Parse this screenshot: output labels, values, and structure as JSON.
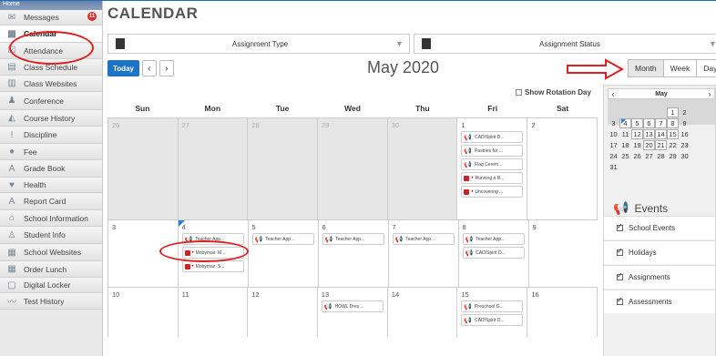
{
  "sidebar": {
    "home": "Home",
    "messages_badge": "11",
    "items": [
      {
        "label": "Messages",
        "icon": "envelope-icon",
        "glyph": "✉"
      },
      {
        "label": "Calendar",
        "icon": "calendar-icon",
        "glyph": "▦"
      },
      {
        "label": "Attendance",
        "icon": "checkmark-icon",
        "glyph": "☑"
      },
      {
        "label": "Class Schedule",
        "icon": "schedule-icon",
        "glyph": "▤"
      },
      {
        "label": "Class Websites",
        "icon": "website-icon",
        "glyph": "▥"
      },
      {
        "label": "Conference",
        "icon": "people-icon",
        "glyph": "♟"
      },
      {
        "label": "Course History",
        "icon": "history-icon",
        "glyph": "◭"
      },
      {
        "label": "Discipline",
        "icon": "alert-icon",
        "glyph": "!"
      },
      {
        "label": "Fee",
        "icon": "fee-icon",
        "glyph": "●"
      },
      {
        "label": "Grade Book",
        "icon": "gradebook-icon",
        "glyph": "A"
      },
      {
        "label": "Health",
        "icon": "health-icon",
        "glyph": "♥"
      },
      {
        "label": "Report Card",
        "icon": "reportcard-icon",
        "glyph": "A"
      },
      {
        "label": "School Information",
        "icon": "school-icon",
        "glyph": "⌂"
      },
      {
        "label": "Student Info",
        "icon": "student-icon",
        "glyph": "♙"
      },
      {
        "label": "School Websites",
        "icon": "buildings-icon",
        "glyph": "▦"
      },
      {
        "label": "Order Lunch",
        "icon": "lunch-icon",
        "glyph": "▦"
      },
      {
        "label": "Digital Locker",
        "icon": "locker-icon",
        "glyph": "▢"
      },
      {
        "label": "Test History",
        "icon": "chart-icon",
        "glyph": "〰"
      }
    ]
  },
  "header": {
    "title": "CALENDAR"
  },
  "filters": {
    "assignment_type": "Assignment Type",
    "assignment_status": "Assignment Status"
  },
  "toolbar": {
    "today": "Today",
    "prev": "‹",
    "next": "›",
    "month_title": "May 2020",
    "views": [
      "Month",
      "Week",
      "Day"
    ]
  },
  "rotation_label": "Show Rotation Day",
  "days_of_week": [
    "Sun",
    "Mon",
    "Tue",
    "Wed",
    "Thu",
    "Fri",
    "Sat"
  ],
  "weeks": [
    {
      "days": [
        {
          "num": "26",
          "other": true,
          "events": []
        },
        {
          "num": "27",
          "other": true,
          "events": []
        },
        {
          "num": "28",
          "other": true,
          "events": []
        },
        {
          "num": "29",
          "other": true,
          "events": []
        },
        {
          "num": "30",
          "other": true,
          "events": []
        },
        {
          "num": "1",
          "events": [
            {
              "kind": "meg",
              "text": "CAD/Spirit D..."
            },
            {
              "kind": "meg",
              "text": "Pastries for ..."
            },
            {
              "kind": "meg",
              "text": "Flag Cerem..."
            },
            {
              "kind": "assign",
              "text": "Running a R..."
            },
            {
              "kind": "assign",
              "text": "Uncovering ..."
            }
          ]
        },
        {
          "num": "2",
          "events": []
        }
      ]
    },
    {
      "days": [
        {
          "num": "3",
          "events": []
        },
        {
          "num": "4",
          "today": true,
          "events": [
            {
              "kind": "meg",
              "text": "Teacher App..."
            },
            {
              "kind": "assign",
              "text": "Mobymax: M..."
            },
            {
              "kind": "assign",
              "text": "Mobymax: S..."
            }
          ]
        },
        {
          "num": "5",
          "events": [
            {
              "kind": "meg",
              "text": "Teacher App..."
            }
          ]
        },
        {
          "num": "6",
          "events": [
            {
              "kind": "meg",
              "text": "Teacher App..."
            }
          ]
        },
        {
          "num": "7",
          "events": [
            {
              "kind": "meg",
              "text": "Teacher App..."
            }
          ]
        },
        {
          "num": "8",
          "events": [
            {
              "kind": "meg",
              "text": "Teacher App..."
            },
            {
              "kind": "meg",
              "text": "CAD/Spirit D..."
            }
          ]
        },
        {
          "num": "9",
          "events": []
        }
      ]
    },
    {
      "days": [
        {
          "num": "10",
          "events": []
        },
        {
          "num": "11",
          "events": []
        },
        {
          "num": "12",
          "events": []
        },
        {
          "num": "13",
          "events": [
            {
              "kind": "meg",
              "text": "HOWL Dres..."
            }
          ]
        },
        {
          "num": "14",
          "events": []
        },
        {
          "num": "15",
          "events": [
            {
              "kind": "meg",
              "text": "Preschool G..."
            },
            {
              "kind": "meg",
              "text": "CAD/Spirit D..."
            }
          ]
        },
        {
          "num": "16",
          "events": []
        }
      ]
    }
  ],
  "mini_calendar": {
    "prev": "‹",
    "title": "May",
    "next": "›",
    "rows": [
      [
        {
          "t": ""
        },
        {
          "t": ""
        },
        {
          "t": ""
        },
        {
          "t": ""
        },
        {
          "t": ""
        },
        {
          "t": "1",
          "box": true
        },
        {
          "t": "2"
        }
      ],
      [
        {
          "t": "3"
        },
        {
          "t": "4",
          "box": true,
          "tri": true
        },
        {
          "t": "5",
          "box": true
        },
        {
          "t": "6",
          "box": true
        },
        {
          "t": "7",
          "box": true
        },
        {
          "t": "8",
          "box": true
        },
        {
          "t": "9"
        }
      ],
      [
        {
          "t": "10"
        },
        {
          "t": "11"
        },
        {
          "t": "12",
          "box": true
        },
        {
          "t": "13",
          "box": true
        },
        {
          "t": "14",
          "box": true
        },
        {
          "t": "15",
          "box": true
        },
        {
          "t": "16"
        }
      ],
      [
        {
          "t": "17"
        },
        {
          "t": "18"
        },
        {
          "t": "19"
        },
        {
          "t": "20",
          "box": true
        },
        {
          "t": "21",
          "box": true
        },
        {
          "t": "22"
        },
        {
          "t": "23"
        }
      ],
      [
        {
          "t": "24"
        },
        {
          "t": "25"
        },
        {
          "t": "26"
        },
        {
          "t": "27"
        },
        {
          "t": "28"
        },
        {
          "t": "29"
        },
        {
          "t": "30"
        }
      ],
      [
        {
          "t": "31"
        },
        {
          "t": ""
        },
        {
          "t": ""
        },
        {
          "t": ""
        },
        {
          "t": ""
        },
        {
          "t": ""
        },
        {
          "t": ""
        }
      ]
    ]
  },
  "events_panel": {
    "title": "Events",
    "items": [
      "School Events",
      "Holidays",
      "Assignments",
      "Assessments"
    ]
  }
}
